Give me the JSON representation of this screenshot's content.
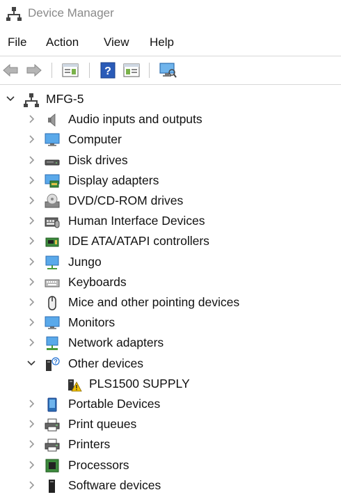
{
  "window": {
    "title": "Device Manager",
    "title_icon": "device-manager-icon"
  },
  "menu": {
    "items": [
      "File",
      "Action",
      "View",
      "Help"
    ]
  },
  "toolbar": {
    "buttons": [
      "back-arrow-icon",
      "forward-arrow-icon",
      "properties-icon",
      "help-icon",
      "update-driver-icon",
      "scan-hardware-icon"
    ]
  },
  "tree": {
    "root": {
      "label": "MFG-5",
      "icon": "computer-tower-icon",
      "expanded": true
    },
    "categories": [
      {
        "label": "Audio inputs and outputs",
        "icon": "speaker-icon",
        "expanded": false
      },
      {
        "label": "Computer",
        "icon": "monitor-icon",
        "expanded": false
      },
      {
        "label": "Disk drives",
        "icon": "disk-drive-icon",
        "expanded": false
      },
      {
        "label": "Display adapters",
        "icon": "display-adapter-icon",
        "expanded": false
      },
      {
        "label": "DVD/CD-ROM drives",
        "icon": "dvd-drive-icon",
        "expanded": false
      },
      {
        "label": "Human Interface Devices",
        "icon": "hid-icon",
        "expanded": false
      },
      {
        "label": "IDE ATA/ATAPI controllers",
        "icon": "ide-controller-icon",
        "expanded": false
      },
      {
        "label": "Jungo",
        "icon": "network-monitor-icon",
        "expanded": false
      },
      {
        "label": "Keyboards",
        "icon": "keyboard-icon",
        "expanded": false
      },
      {
        "label": "Mice and other pointing devices",
        "icon": "mouse-icon",
        "expanded": false
      },
      {
        "label": "Monitors",
        "icon": "monitor-icon",
        "expanded": false
      },
      {
        "label": "Network adapters",
        "icon": "network-adapter-icon",
        "expanded": false
      },
      {
        "label": "Other devices",
        "icon": "unknown-device-icon",
        "expanded": true,
        "children": [
          {
            "label": "PLS1500 SUPPLY",
            "icon": "warning-device-icon"
          }
        ]
      },
      {
        "label": "Portable Devices",
        "icon": "portable-device-icon",
        "expanded": false
      },
      {
        "label": "Print queues",
        "icon": "printer-icon",
        "expanded": false
      },
      {
        "label": "Printers",
        "icon": "printer-icon",
        "expanded": false
      },
      {
        "label": "Processors",
        "icon": "processor-icon",
        "expanded": false
      },
      {
        "label": "Software devices",
        "icon": "software-device-icon",
        "expanded": false
      }
    ]
  },
  "colors": {
    "title_text": "#8a8a8a",
    "accent_blue": "#1f6fd1",
    "warning_yellow": "#f0c000"
  }
}
